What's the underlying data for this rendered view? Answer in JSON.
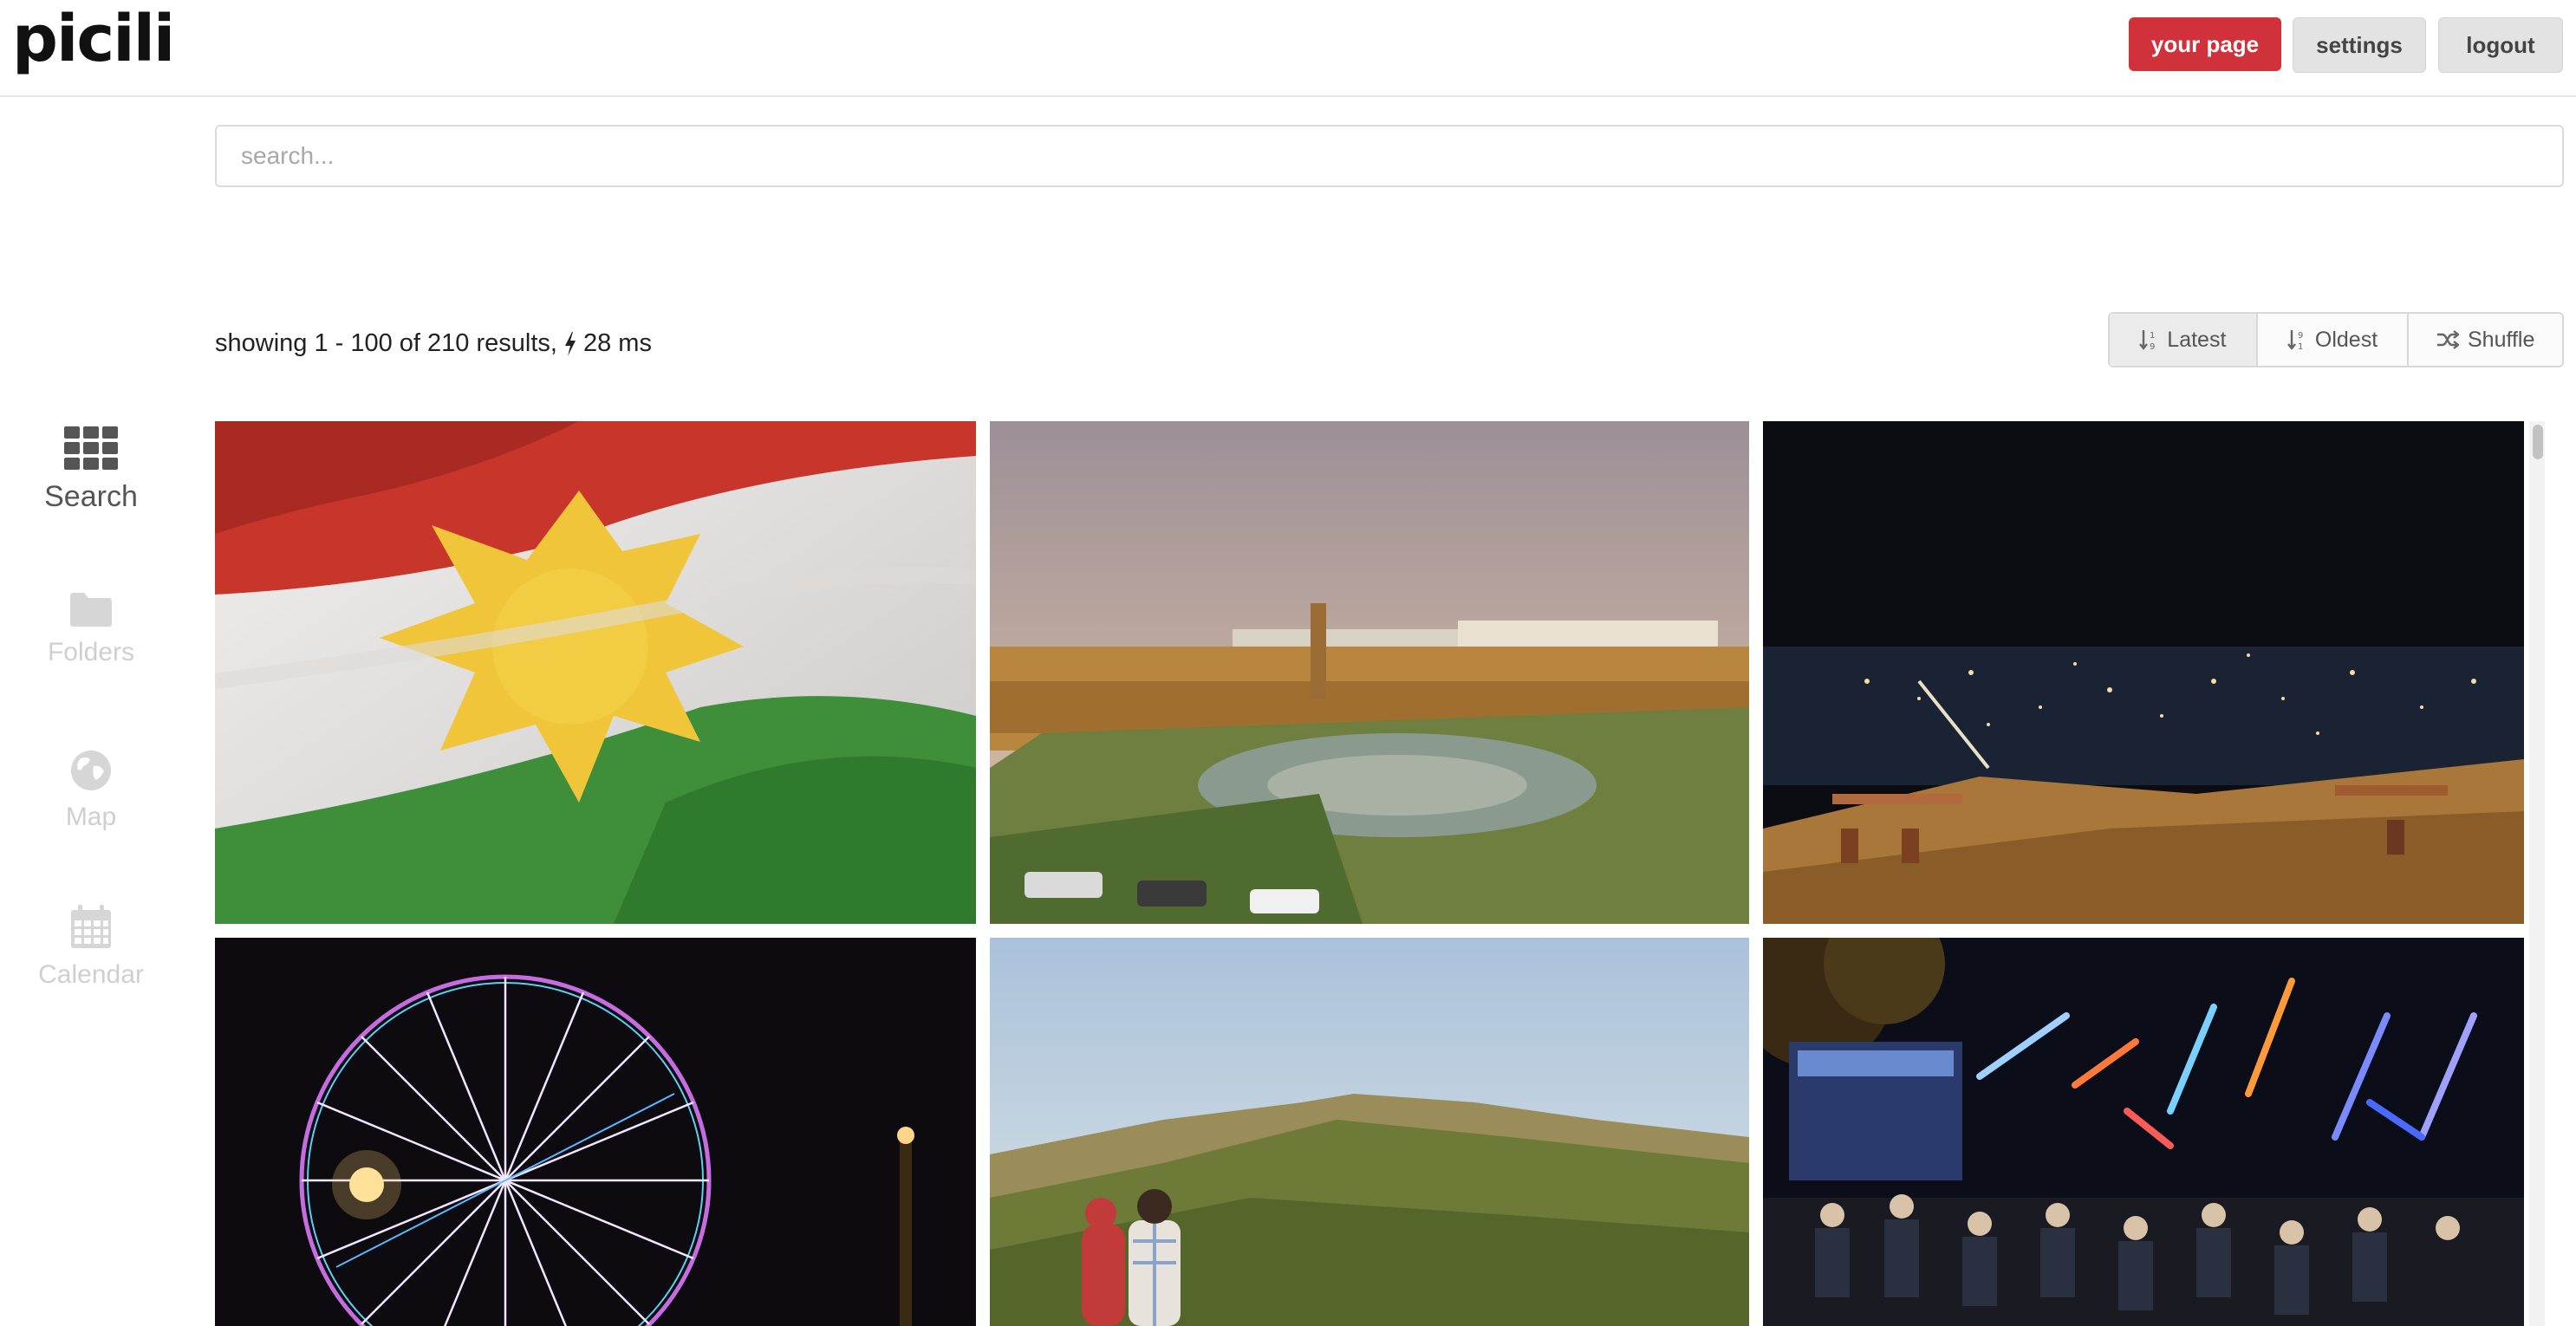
{
  "header": {
    "logo": "picili",
    "your_page_label": "your page",
    "settings_label": "settings",
    "logout_label": "logout",
    "accent_color": "#d0313a"
  },
  "search": {
    "placeholder": "search...",
    "value": ""
  },
  "results": {
    "summary": "showing 1 - 100 of 210 results,",
    "time": "28 ms"
  },
  "sort": {
    "options": [
      {
        "label": "Latest",
        "icon": "sort-desc-icon",
        "active": true
      },
      {
        "label": "Oldest",
        "icon": "sort-asc-icon",
        "active": false
      },
      {
        "label": "Shuffle",
        "icon": "shuffle-icon",
        "active": false
      }
    ]
  },
  "sidebar": {
    "items": [
      {
        "label": "Search",
        "icon": "grid-icon",
        "active": true
      },
      {
        "label": "Folders",
        "icon": "folder-icon",
        "active": false
      },
      {
        "label": "Map",
        "icon": "globe-icon",
        "active": false
      },
      {
        "label": "Calendar",
        "icon": "calendar-icon",
        "active": false
      }
    ]
  },
  "gallery": {
    "photos": [
      {
        "subject": "kurdistan-flag"
      },
      {
        "subject": "city-square-citadel"
      },
      {
        "subject": "city-lights-night"
      },
      {
        "subject": "ferris-wheel-night"
      },
      {
        "subject": "hills-landscape-couple"
      },
      {
        "subject": "neon-lights-cafe"
      }
    ]
  }
}
